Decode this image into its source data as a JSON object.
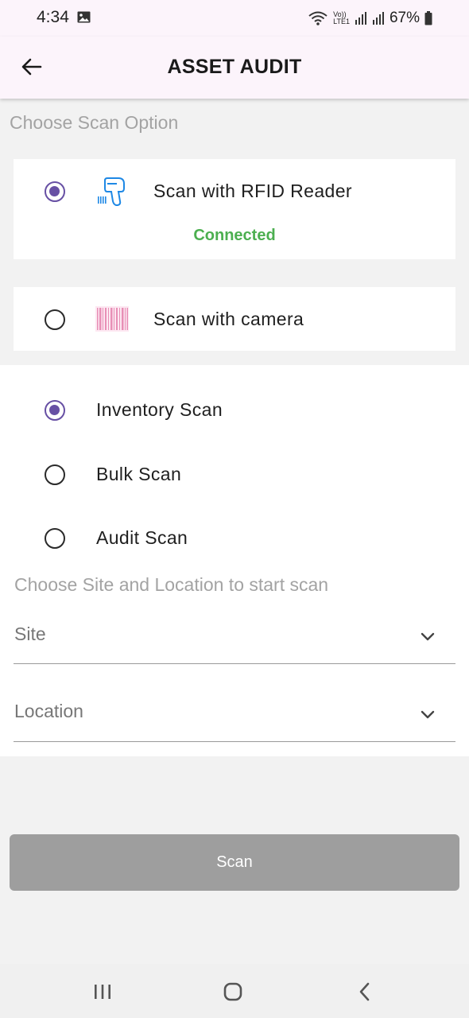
{
  "status_bar": {
    "time": "4:34",
    "volte_top": "Vo))",
    "volte_bottom": "LTE1",
    "battery": "67%"
  },
  "app_bar": {
    "title": "ASSET AUDIT",
    "back_icon": "arrow-back-icon"
  },
  "scan_option": {
    "heading": "Choose Scan Option",
    "options": [
      {
        "label": "Scan with RFID Reader",
        "icon": "rfid-scanner-icon",
        "selected": true,
        "status": "Connected"
      },
      {
        "label": "Scan with camera",
        "icon": "barcode-icon",
        "selected": false
      }
    ]
  },
  "scan_type": {
    "options": [
      {
        "label": "Inventory Scan",
        "selected": true
      },
      {
        "label": "Bulk Scan",
        "selected": false
      },
      {
        "label": "Audit Scan",
        "selected": false
      }
    ]
  },
  "site_location": {
    "heading": "Choose Site and Location to start scan",
    "site_label": "Site",
    "location_label": "Location"
  },
  "actions": {
    "scan_label": "Scan"
  },
  "colors": {
    "accent": "#6750a4",
    "connected": "#4caf50",
    "app_bar_bg": "#fcf4fb",
    "button_disabled": "#9e9e9e"
  },
  "nav_bar": {
    "recents_icon": "recents-icon",
    "home_icon": "home-icon",
    "back_icon": "nav-back-icon"
  }
}
